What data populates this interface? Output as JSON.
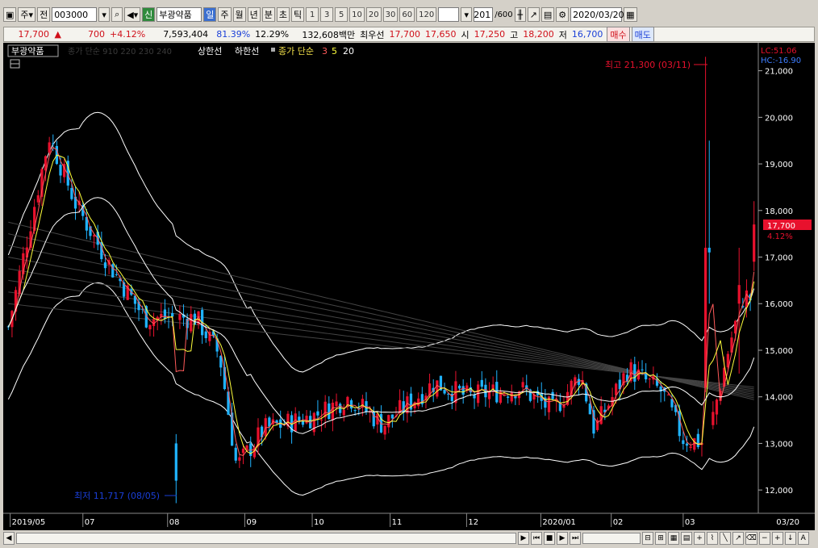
{
  "toolbar": {
    "period": "주",
    "range": "전",
    "code": "003000",
    "market_badge": "신",
    "stock_name": "부광약품",
    "periods": [
      "일",
      "주",
      "월",
      "년"
    ],
    "intraday": [
      "분",
      "초",
      "틱"
    ],
    "intervals": [
      "1",
      "3",
      "5",
      "10",
      "20",
      "30",
      "60",
      "120"
    ],
    "count_current": "201",
    "count_total": "/600",
    "date": "2020/03/20"
  },
  "quote": {
    "price": "17,700",
    "change": "700",
    "change_pct": "+4.12%",
    "volume": "7,593,404",
    "vol_ratio": "81.39%",
    "turnover": "12.29%",
    "amount": "132,608백만",
    "best_label": "최우선",
    "ask": "17,700",
    "bid": "17,650",
    "open_label": "시",
    "open": "17,250",
    "high_label": "고",
    "high": "18,200",
    "low_label": "저",
    "low": "16,700",
    "buy_button": "매수",
    "sell_button": "매도"
  },
  "legend": {
    "name": "부광약품",
    "hidden_ma": "종가 단순 910 220 230 240",
    "upper_limit": "상한선",
    "lower_limit": "하한선",
    "ma_label": "종가 단순",
    "ma_periods": [
      "3",
      "5",
      "20"
    ]
  },
  "colors": {
    "up": "#e8112d",
    "down": "#1fb3ff",
    "ma3": "#ff5a5a",
    "ma5": "#ffff3c",
    "ma20": "#ffffff",
    "band": "#ffffff"
  },
  "chart_data": {
    "type": "candlestick",
    "ylim": [
      11500,
      21600
    ],
    "y_ticks": [
      "21,000",
      "20,000",
      "19,000",
      "18,000",
      "17,000",
      "16,000",
      "15,000",
      "14,000",
      "13,000",
      "12,000"
    ],
    "x_labels": [
      "2019/05",
      "07",
      "08",
      "09",
      "10",
      "11",
      "12",
      "2020/01",
      "02",
      "03",
      "03/20"
    ],
    "high_annotation": "최고 21,300 (03/11)",
    "low_annotation": "최저 11,717 (08/05)",
    "lc": "LC:51.06",
    "hc": "HC:-16.90",
    "last_price": "17,700",
    "last_pct": "4.12%"
  }
}
